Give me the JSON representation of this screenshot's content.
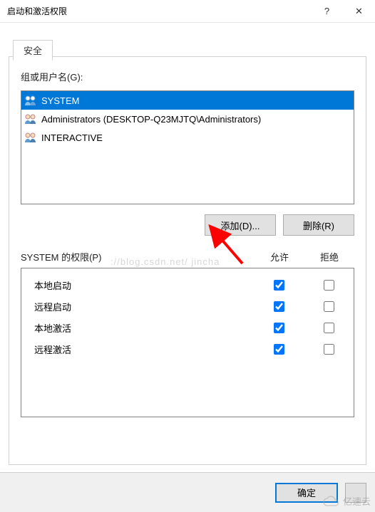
{
  "window": {
    "title": "启动和激活权限",
    "help_tip": "?",
    "close_tip": "✕"
  },
  "tab": {
    "label": "安全"
  },
  "labels": {
    "groups_users": "组或用户名(G):",
    "add_button": "添加(D)...",
    "remove_button": "删除(R)",
    "permissions_for": "SYSTEM 的权限(P)",
    "allow": "允许",
    "deny": "拒绝"
  },
  "users": [
    {
      "name": "SYSTEM",
      "selected": true
    },
    {
      "name": "Administrators (DESKTOP-Q23MJTQ\\Administrators)",
      "selected": false
    },
    {
      "name": "INTERACTIVE",
      "selected": false
    }
  ],
  "permissions": [
    {
      "label": "本地启动",
      "allow": true,
      "deny": false
    },
    {
      "label": "远程启动",
      "allow": true,
      "deny": false
    },
    {
      "label": "本地激活",
      "allow": true,
      "deny": false
    },
    {
      "label": "远程激活",
      "allow": true,
      "deny": false
    }
  ],
  "footer": {
    "ok": "确定",
    "cancel": ""
  },
  "watermark": "://blog.csdn.net/   jincha",
  "wm_brand": "亿速云"
}
